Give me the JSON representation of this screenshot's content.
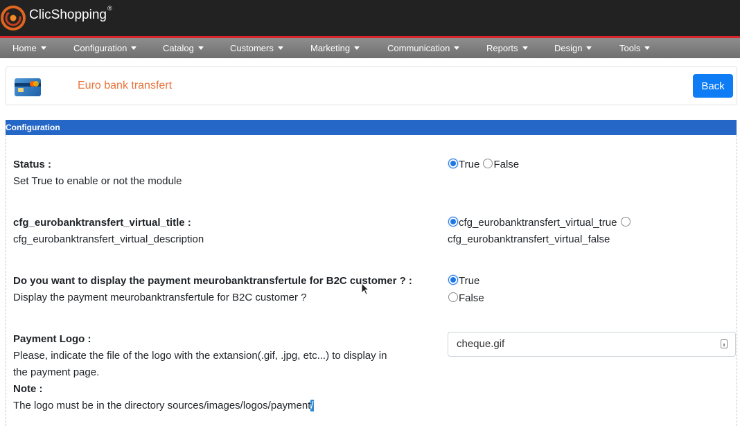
{
  "app": {
    "logo_text": "ClicShopping",
    "logo_reg": "®"
  },
  "nav": [
    {
      "label": "Home"
    },
    {
      "label": "Configuration"
    },
    {
      "label": "Catalog"
    },
    {
      "label": "Customers"
    },
    {
      "label": "Marketing"
    },
    {
      "label": "Communication"
    },
    {
      "label": "Reports"
    },
    {
      "label": "Design"
    },
    {
      "label": "Tools"
    }
  ],
  "header": {
    "title": "Euro bank transfert",
    "back_label": "Back",
    "icon": "credit-card-icon"
  },
  "section": {
    "title": "Configuration"
  },
  "rows": [
    {
      "title": "Status :",
      "description": "Set True to enable or not the module",
      "options": [
        "True",
        "False"
      ],
      "selected": "True"
    },
    {
      "title": "cfg_eurobanktransfert_virtual_title :",
      "description": "cfg_eurobanktransfert_virtual_description",
      "options": [
        "cfg_eurobanktransfert_virtual_true",
        "cfg_eurobanktransfert_virtual_false"
      ],
      "selected": "cfg_eurobanktransfert_virtual_true"
    },
    {
      "title": "Do you want to display the payment meurobanktransfertule for B2C customer ? :",
      "description": "Display the payment meurobanktransfertule for B2C customer ?",
      "options": [
        "True",
        "False"
      ],
      "selected": "True"
    },
    {
      "title": "Payment Logo :",
      "description_line1": "Please, indicate the file of the logo with the extansion(.gif, .jpg, etc...) to display in",
      "description_line2": "the payment page.",
      "note_label": "Note :",
      "note_text": "The logo must be in the directory sources/images/logos/payment",
      "note_highlight": "/",
      "value": "cheque.gif"
    }
  ],
  "colors": {
    "accent": "#0d7cf5",
    "section_bar": "#2567c7",
    "title_orange": "#e9743c",
    "topbar": "#222222",
    "red_line": "#d9262b"
  }
}
